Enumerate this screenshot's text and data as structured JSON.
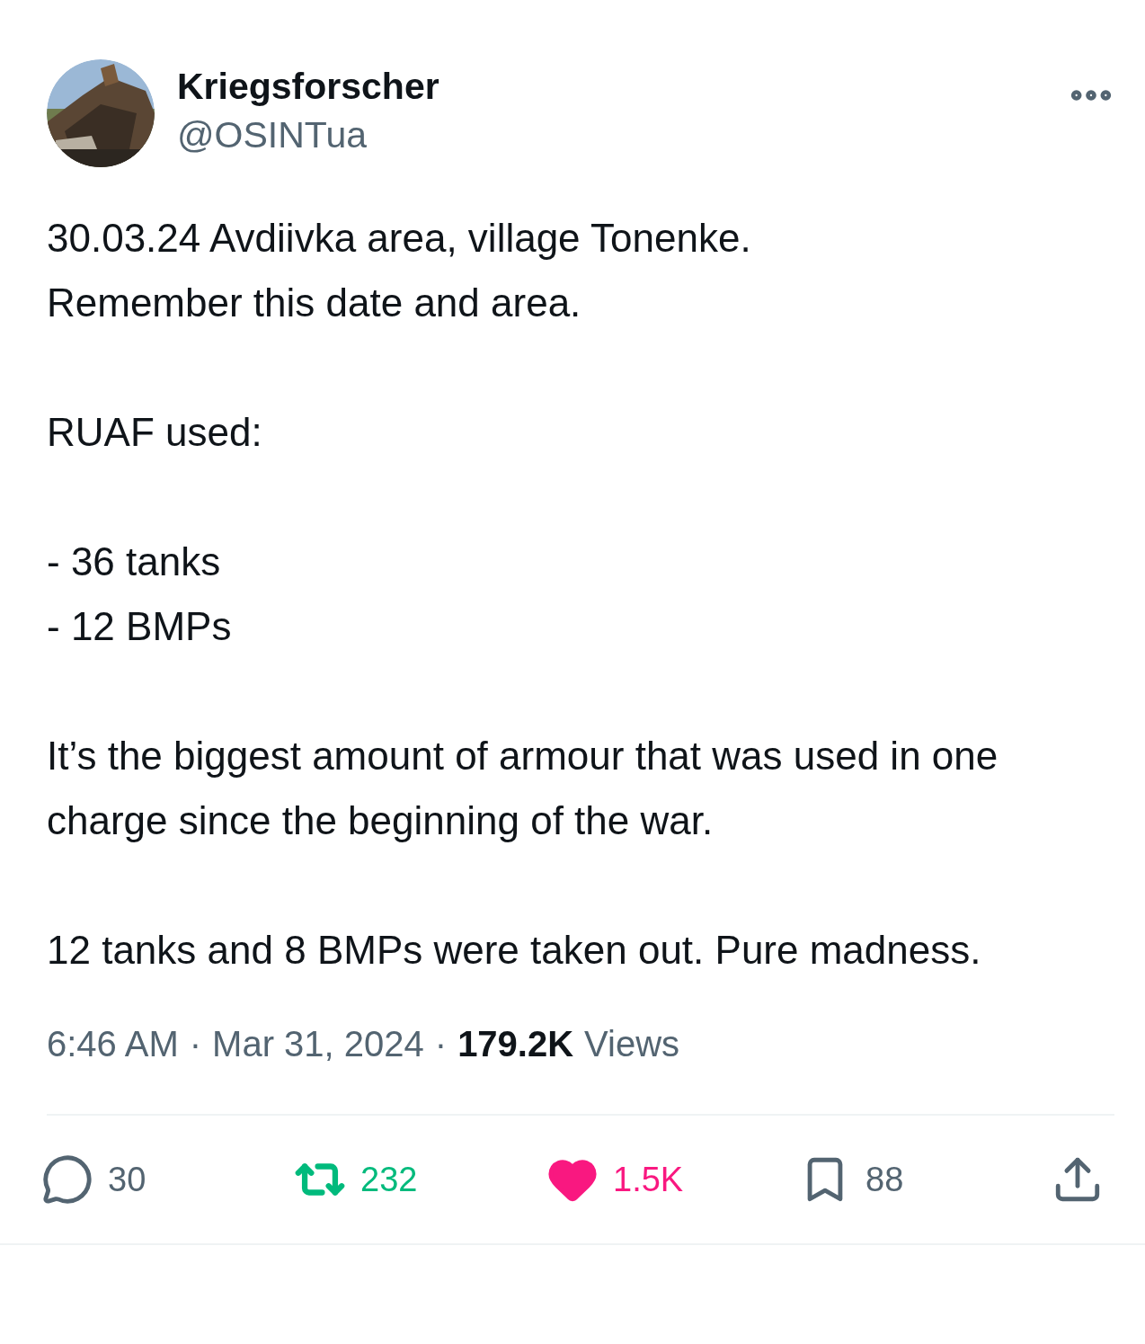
{
  "author": {
    "name": "Kriegsforscher",
    "handle": "@OSINTua"
  },
  "paragraphs": [
    {
      "lines": [
        "30.03.24 Avdiivka area, village Tonenke.",
        "Remember this date and area."
      ]
    },
    {
      "lines": [
        "RUAF used:"
      ]
    },
    {
      "lines": [
        "- 36 tanks",
        "- 12 BMPs"
      ]
    },
    {
      "lines": [
        "It’s the biggest amount of armour that was used in one charge since the beginning of the war."
      ]
    },
    {
      "lines": [
        "12 tanks and 8 BMPs were taken out. Pure madness."
      ]
    }
  ],
  "meta": [
    {
      "kind": "text",
      "text": "6:46 AM"
    },
    {
      "kind": "separator",
      "text": "·"
    },
    {
      "kind": "text",
      "text": "Mar 31, 2024"
    },
    {
      "kind": "separator",
      "text": "·"
    },
    {
      "kind": "count",
      "text": "179.2K"
    },
    {
      "kind": "text",
      "text": "Views"
    }
  ],
  "actions": [
    {
      "kind": "reply",
      "count": "30",
      "active": false
    },
    {
      "kind": "repost",
      "count": "232",
      "active": true
    },
    {
      "kind": "like",
      "count": "1.5K",
      "active": true
    },
    {
      "kind": "bookmark",
      "count": "88",
      "active": false
    },
    {
      "kind": "share",
      "active": false
    }
  ]
}
